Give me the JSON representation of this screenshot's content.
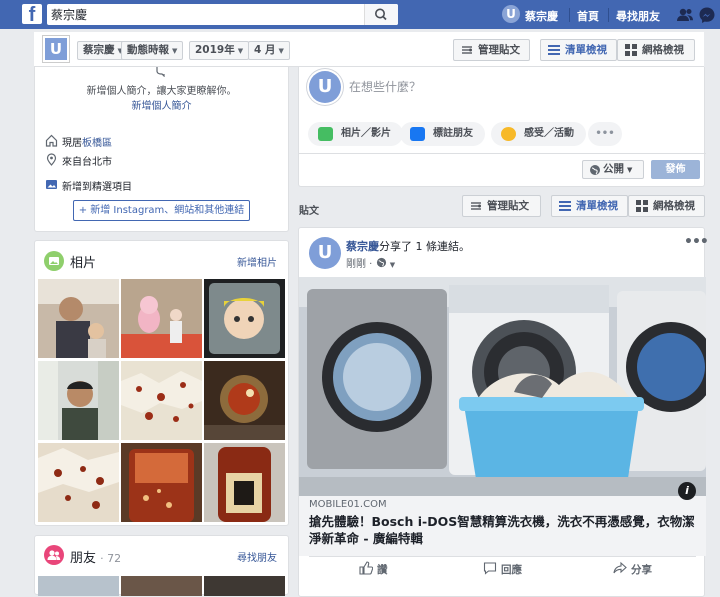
{
  "topbar": {
    "logo": "f",
    "search_value": "蔡宗慶",
    "search_icon": "search-icon",
    "profile_initial": "U",
    "profile_name": "蔡宗慶",
    "home_label": "首頁",
    "find_friends_label": "尋找朋友",
    "icons": [
      "friends-icon",
      "messenger-icon"
    ]
  },
  "timeline_nav": {
    "profile_initial": "U",
    "name_dropdown": "蔡宗慶",
    "activity_dropdown": "動態時報",
    "year_dropdown": "2019年",
    "month_dropdown": "4 月",
    "manage_posts": "管理貼文",
    "list_view": "清單檢視",
    "grid_view": "網格檢視"
  },
  "intro": {
    "bio_prompt": "新增個人簡介，讓大家更瞭解你。",
    "add_bio": "新增個人簡介",
    "lives_in_prefix": "現居",
    "lives_in_place": "板橋區",
    "from": "來自台北市",
    "add_featured": "新增到精選項目",
    "add_links": "+ 新增 Instagram、網站和其他連結"
  },
  "photos": {
    "title": "相片",
    "action": "新增相片"
  },
  "friends": {
    "title": "朋友",
    "count": "· 72",
    "action": "尋找朋友"
  },
  "composer": {
    "profile_initial": "U",
    "placeholder": "在想些什麼？",
    "photo_video": "相片／影片",
    "tag_friends": "標註朋友",
    "feeling": "感受／活動",
    "more": "•••",
    "privacy": "公開",
    "publish": "發佈"
  },
  "posts_section": {
    "label": "貼文",
    "manage_posts": "管理貼文",
    "list_view": "清單檢視",
    "grid_view": "網格檢視"
  },
  "post": {
    "profile_initial": "U",
    "author": "蔡宗慶",
    "action": "分享了 1 條連結。",
    "time": "剛剛 ·",
    "more": "•••",
    "link_domain": "MOBILE01.COM",
    "link_title": "搶先體驗！Bosch i-DOS智慧精算洗衣機，洗衣不再憑感覺，衣物潔淨新革命 - 廣編特輯",
    "info": "i",
    "like": "讚",
    "comment": "回應",
    "share": "分享"
  },
  "colors": {
    "topbar": "#4267b2",
    "link": "#385898",
    "publish_disabled": "#9cb4d8"
  }
}
